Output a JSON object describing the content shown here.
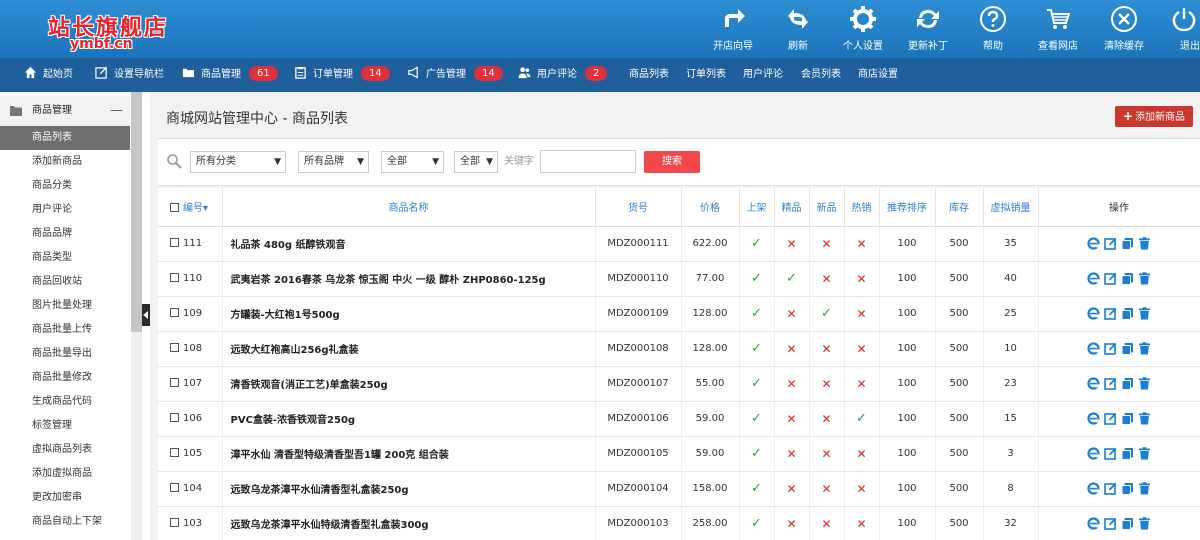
{
  "logo": {
    "cn": "站长旗舰店",
    "en": "ymbf.cn"
  },
  "toolbar": [
    {
      "label": "开店向导",
      "icon": "arrow-forward-icon"
    },
    {
      "label": "刷新",
      "icon": "refresh-icon"
    },
    {
      "label": "个人设置",
      "icon": "gear-icon"
    },
    {
      "label": "更新补丁",
      "icon": "sync-icon"
    },
    {
      "label": "帮助",
      "icon": "help-icon"
    },
    {
      "label": "查看网店",
      "icon": "cart-icon"
    },
    {
      "label": "清除缓存",
      "icon": "close-circle-icon"
    },
    {
      "label": "退出",
      "icon": "power-icon"
    }
  ],
  "nav": [
    {
      "label": "起始页",
      "icon": "home-icon"
    },
    {
      "label": "设置导航栏",
      "icon": "edit-icon"
    },
    {
      "label": "商品管理",
      "icon": "folder-icon",
      "badge": "61"
    },
    {
      "label": "订单管理",
      "icon": "clipboard-icon",
      "badge": "14"
    },
    {
      "label": "广告管理",
      "icon": "megaphone-icon",
      "badge": "14"
    },
    {
      "label": "用户评论",
      "icon": "users-icon",
      "badge": "2"
    },
    {
      "label": "商品列表"
    },
    {
      "label": "订单列表"
    },
    {
      "label": "用户评论"
    },
    {
      "label": "会员列表"
    },
    {
      "label": "商店设置"
    }
  ],
  "sidebar": {
    "header": "商品管理",
    "collapse": "—",
    "items": [
      "商品列表",
      "添加新商品",
      "商品分类",
      "用户评论",
      "商品品牌",
      "商品类型",
      "商品回收站",
      "图片批量处理",
      "商品批量上传",
      "商品批量导出",
      "商品批量修改",
      "生成商品代码",
      "标签管理",
      "虚拟商品列表",
      "添加虚拟商品",
      "更改加密串",
      "商品自动上下架"
    ],
    "active_index": 0
  },
  "main": {
    "title": "商城网站管理中心 - 商品列表",
    "add_button": "添加新商品",
    "filters": {
      "category": "所有分类",
      "brand": "所有品牌",
      "status1": "全部",
      "status2": "全部",
      "keyword_label": "关键字",
      "keyword_value": "",
      "search_button": "搜索"
    }
  },
  "table": {
    "headers": [
      "编号",
      "商品名称",
      "货号",
      "价格",
      "上架",
      "精品",
      "新品",
      "热销",
      "推荐排序",
      "库存",
      "虚拟销量",
      "操作"
    ],
    "sort_indicator": "▾",
    "rows": [
      {
        "id": "111",
        "name": "礼品茶 480g 纸醇铁观音",
        "sn": "MDZ000111",
        "price": "622.00",
        "on_sale": true,
        "best": false,
        "new": false,
        "hot": false,
        "sort": "100",
        "stock": "500",
        "virtual_sales": "35"
      },
      {
        "id": "110",
        "name": "武夷岩茶 2016春茶 乌龙茶 惊玉阁 中火 一级 醇朴 ZHP0860-125g",
        "sn": "MDZ000110",
        "price": "77.00",
        "on_sale": true,
        "best": true,
        "new": false,
        "hot": false,
        "sort": "100",
        "stock": "500",
        "virtual_sales": "40"
      },
      {
        "id": "109",
        "name": "方罐装-大红袍1号500g",
        "sn": "MDZ000109",
        "price": "128.00",
        "on_sale": true,
        "best": false,
        "new": true,
        "hot": false,
        "sort": "100",
        "stock": "500",
        "virtual_sales": "25"
      },
      {
        "id": "108",
        "name": "远致大红袍高山256g礼盒装",
        "sn": "MDZ000108",
        "price": "128.00",
        "on_sale": true,
        "best": false,
        "new": false,
        "hot": false,
        "sort": "100",
        "stock": "500",
        "virtual_sales": "10"
      },
      {
        "id": "107",
        "name": "清香铁观音(消正工艺)单盒装250g",
        "sn": "MDZ000107",
        "price": "55.00",
        "on_sale": true,
        "best": false,
        "new": false,
        "hot": false,
        "sort": "100",
        "stock": "500",
        "virtual_sales": "23"
      },
      {
        "id": "106",
        "name": "PVC盒装-浓香铁观音250g",
        "sn": "MDZ000106",
        "price": "59.00",
        "on_sale": true,
        "best": false,
        "new": false,
        "hot": true,
        "sort": "100",
        "stock": "500",
        "virtual_sales": "15"
      },
      {
        "id": "105",
        "name": "漳平水仙 清香型特级清香型吾1罐 200克 组合装",
        "sn": "MDZ000105",
        "price": "59.00",
        "on_sale": true,
        "best": false,
        "new": false,
        "hot": false,
        "sort": "100",
        "stock": "500",
        "virtual_sales": "3"
      },
      {
        "id": "104",
        "name": "远致乌龙茶漳平水仙清香型礼盒装250g",
        "sn": "MDZ000104",
        "price": "158.00",
        "on_sale": true,
        "best": false,
        "new": false,
        "hot": false,
        "sort": "100",
        "stock": "500",
        "virtual_sales": "8"
      },
      {
        "id": "103",
        "name": "远致乌龙茶漳平水仙特级清香型礼盒装300g",
        "sn": "MDZ000103",
        "price": "258.00",
        "on_sale": true,
        "best": false,
        "new": false,
        "hot": false,
        "sort": "100",
        "stock": "500",
        "virtual_sales": "32"
      }
    ],
    "ops_icons": [
      "ie-view-icon",
      "edit-icon",
      "copy-icon",
      "trash-icon"
    ]
  },
  "colors": {
    "header_blue": "#1f83cf",
    "nav_blue": "#1f5f9b",
    "accent_red": "#e8232b",
    "check_green": "#27a33a",
    "link_blue": "#2f7fd0"
  }
}
